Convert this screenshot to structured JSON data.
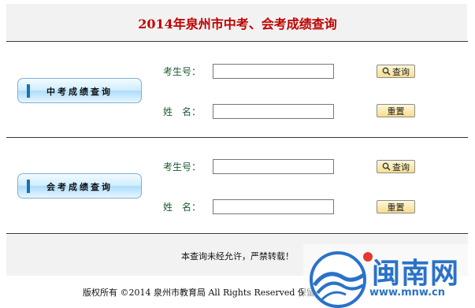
{
  "page_title": "2014年泉州市中考、会考成绩查询",
  "sections": [
    {
      "button_label": "中考成绩查询",
      "field1_label": "考生号：",
      "field2_label": "姓　名：",
      "query_button": "查询",
      "reset_button": "重置",
      "field1_value": "",
      "field2_value": ""
    },
    {
      "button_label": "会考成绩查询",
      "field1_label": "考生号：",
      "field2_label": "姓　名：",
      "query_button": "查询",
      "reset_button": "重置",
      "field1_value": "",
      "field2_value": ""
    }
  ],
  "notice": "本查询未经允许，严禁转载！",
  "copyright": "版权所有 ©2014 泉州市教育局 All Rights Reserved 保留所有权利",
  "watermark": {
    "brand": "闽南网",
    "url": "www.mnw.cn"
  },
  "colors": {
    "title": "#c00000",
    "label": "#1c5b2c",
    "watermark": "#2a72c8"
  },
  "icons": [
    "search-icon"
  ]
}
